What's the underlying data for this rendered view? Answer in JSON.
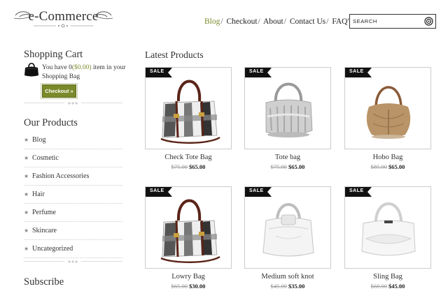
{
  "header": {
    "logo_text": "e-Commerce",
    "nav": [
      {
        "label": "Blog",
        "active": true
      },
      {
        "label": "Checkout",
        "active": false
      },
      {
        "label": "About",
        "active": false
      },
      {
        "label": "Contact Us",
        "active": false
      },
      {
        "label": "FAQ's",
        "active": false
      }
    ],
    "separator": "/",
    "search": {
      "placeholder": "SEARCH",
      "icon": "search-icon"
    }
  },
  "sidebar": {
    "cart": {
      "title": "Shopping Cart",
      "text_before": "You have 0",
      "amount": "($0.00)",
      "text_after": " item in your Shopping Bag",
      "checkout_label": "Checkout »",
      "icon": "shopping-bag-icon"
    },
    "categories": {
      "title": "Our Products",
      "bullet": "★",
      "items": [
        "Blog",
        "Cosmetic",
        "Fashion Accessories",
        "Hair",
        "Perfume",
        "Skincare",
        "Uncategorized"
      ]
    },
    "subscribe_title": "Subscribe"
  },
  "main": {
    "title": "Latest Products",
    "sale_label": "SALE",
    "products": [
      {
        "name": "Check Tote Bag",
        "old_price": "$75.00",
        "price": "$65.00",
        "sale": true,
        "style": "check"
      },
      {
        "name": "Tote bag",
        "old_price": "$75.00",
        "price": "$65.00",
        "sale": true,
        "style": "silver"
      },
      {
        "name": "Hobo Bag",
        "old_price": "$85.00",
        "price": "$65.00",
        "sale": true,
        "style": "tan"
      },
      {
        "name": "Lowry Bag",
        "old_price": "$65.00",
        "price": "$30.00",
        "sale": true,
        "style": "check"
      },
      {
        "name": "Medium soft knot",
        "old_price": "$45.00",
        "price": "$35.00",
        "sale": true,
        "style": "white"
      },
      {
        "name": "Sling Bag",
        "old_price": "$60.00",
        "price": "$45.00",
        "sale": true,
        "style": "white2"
      }
    ]
  },
  "colors": {
    "accent": "#7a8a2a",
    "sale_bg": "#111111",
    "text": "#333333"
  }
}
